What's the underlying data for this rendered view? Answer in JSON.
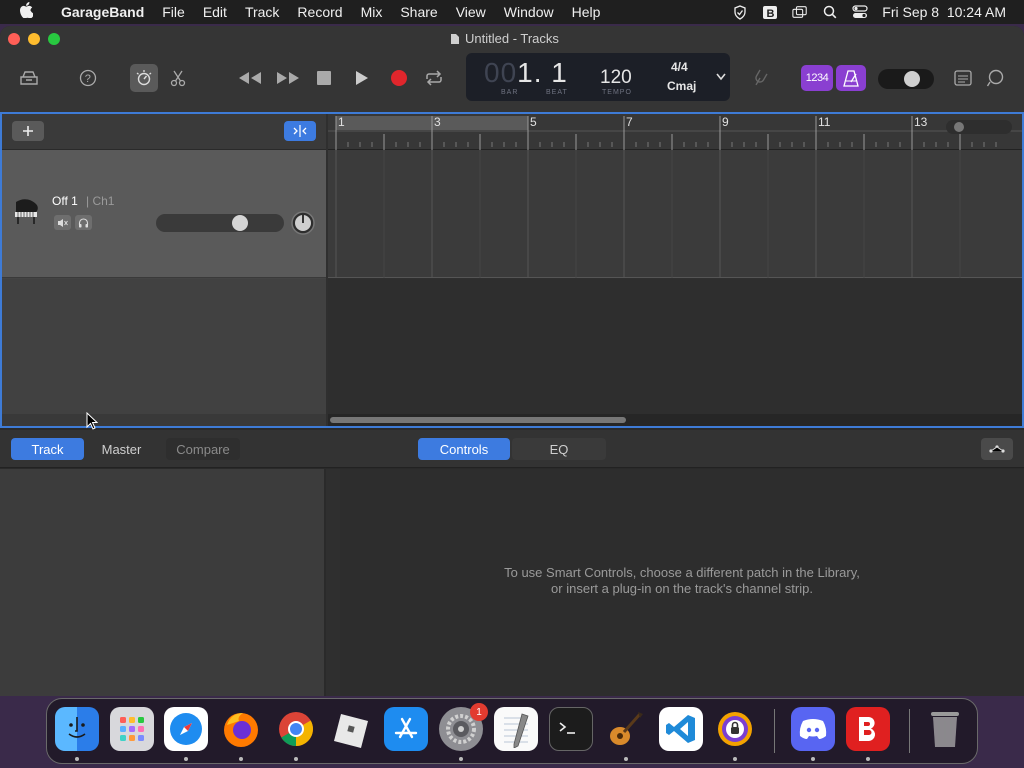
{
  "menubar": {
    "app_name": "GarageBand",
    "items": [
      "File",
      "Edit",
      "Track",
      "Record",
      "Mix",
      "Share",
      "View",
      "Window",
      "Help"
    ],
    "datetime": "Fri Sep 8  10:24 AM"
  },
  "window": {
    "title": "Untitled - Tracks"
  },
  "lcd": {
    "bar_dim": "00",
    "position": "1. 1",
    "bar_label": "BAR",
    "beat_label": "BEAT",
    "tempo": "120",
    "tempo_label": "TEMPO",
    "time_signature": "4/4",
    "key": "Cmaj"
  },
  "count_in_label": "1234",
  "track": {
    "name": "Off 1",
    "channel": "| Ch1",
    "volume": 0.68
  },
  "ruler": {
    "bars": [
      "1",
      "3",
      "5",
      "7",
      "9",
      "11",
      "13"
    ]
  },
  "pane": {
    "tabs_left": [
      "Track",
      "Master",
      "Compare"
    ],
    "tabs_center": [
      "Controls",
      "EQ"
    ],
    "message_line1": "To use Smart Controls, choose a different patch in the Library,",
    "message_line2": "or insert a plug-in on the track's channel strip."
  },
  "dock": {
    "settings_badge": "1",
    "apps": [
      "Finder",
      "Launchpad",
      "Safari",
      "Firefox",
      "Chrome",
      "Roblox",
      "App Store",
      "System Settings",
      "TextEdit",
      "Terminal",
      "GarageBand",
      "Visual Studio Code",
      "Tor Browser",
      "Discord",
      "Bitdefender",
      "Trash"
    ]
  },
  "colors": {
    "accent": "#3d7be0",
    "record": "#e0262c",
    "count_in": "#8a3fd1",
    "selection_border": "#3e7bd6"
  }
}
